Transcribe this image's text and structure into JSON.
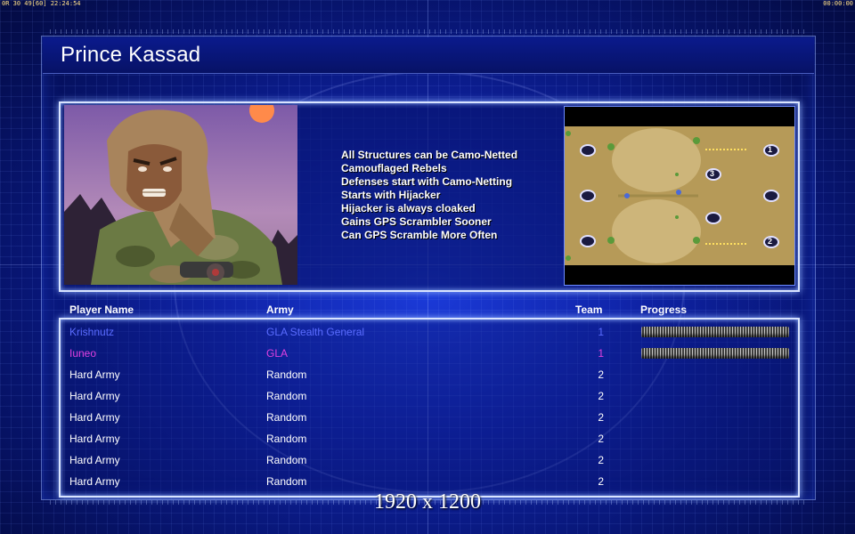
{
  "status_bar": {
    "left": "0R 30 49[60] 22:24:54",
    "right": "00:00:00"
  },
  "general": {
    "name": "Prince Kassad",
    "traits": [
      "All Structures can be Camo-Netted",
      "Camouflaged Rebels",
      "Defenses start with Camo-Netting",
      "Starts with Hijacker",
      "Hijacker is always cloaked",
      "Gains GPS Scrambler Sooner",
      "Can GPS Scramble More Often"
    ]
  },
  "minimap": {
    "start_markers": [
      "1",
      "2",
      "3"
    ]
  },
  "table": {
    "headers": {
      "player_name": "Player Name",
      "army": "Army",
      "team": "Team",
      "progress": "Progress"
    },
    "rows": [
      {
        "name": "Krishnutz",
        "army": "GLA Stealth General",
        "team": "1",
        "color": "#5a6cff",
        "progress": 1.0
      },
      {
        "name": "Iuneo",
        "army": "GLA",
        "team": "1",
        "color": "#e040e0",
        "progress": 1.0
      },
      {
        "name": "Hard Army",
        "army": "Random",
        "team": "2",
        "color": "#ffffff",
        "progress": null
      },
      {
        "name": "Hard Army",
        "army": "Random",
        "team": "2",
        "color": "#ffffff",
        "progress": null
      },
      {
        "name": "Hard Army",
        "army": "Random",
        "team": "2",
        "color": "#ffffff",
        "progress": null
      },
      {
        "name": "Hard Army",
        "army": "Random",
        "team": "2",
        "color": "#ffffff",
        "progress": null
      },
      {
        "name": "Hard Army",
        "army": "Random",
        "team": "2",
        "color": "#ffffff",
        "progress": null
      },
      {
        "name": "Hard Army",
        "army": "Random",
        "team": "2",
        "color": "#ffffff",
        "progress": null
      }
    ]
  },
  "resolution_label": "1920 x 1200"
}
